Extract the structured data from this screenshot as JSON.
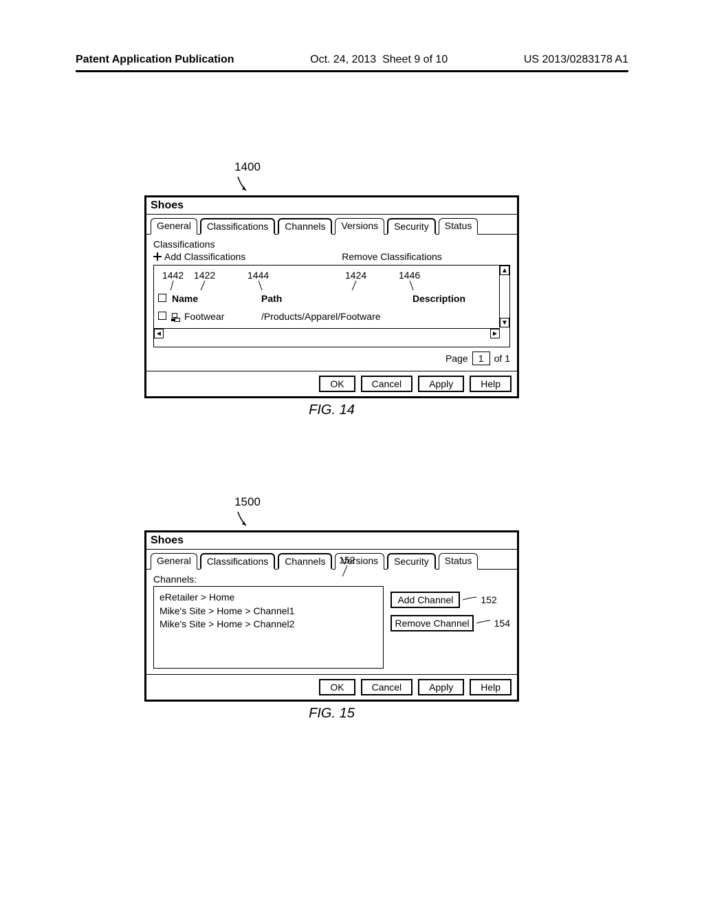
{
  "header": {
    "left": "Patent Application Publication",
    "date": "Oct. 24, 2013",
    "sheet": "Sheet 9 of 10",
    "pubnum": "US 2013/0283178 A1"
  },
  "fig14": {
    "ref": "1400",
    "title": "Shoes",
    "tabs": [
      "General",
      "Classifications",
      "Channels",
      "Versions",
      "Security",
      "Status"
    ],
    "panel_title": "Classifications",
    "link_add": "Add Classifications",
    "link_remove": "Remove Classifications",
    "col_name": "Name",
    "col_path": "Path",
    "col_desc": "Description",
    "row_name": "Footwear",
    "row_path": "/Products/Apparel/Footware",
    "refnums": {
      "a": "1442",
      "b": "1422",
      "c": "1444",
      "d": "1424",
      "e": "1446"
    },
    "pager_page": "Page",
    "pager_current": "1",
    "pager_of": "of 1",
    "buttons": {
      "ok": "OK",
      "cancel": "Cancel",
      "apply": "Apply",
      "help": "Help"
    },
    "caption": "FIG. 14"
  },
  "fig15": {
    "ref": "1500",
    "title": "Shoes",
    "tabs": [
      "General",
      "Classifications",
      "Channels",
      "Versions",
      "Security",
      "Status"
    ],
    "panel_label": "Channels:",
    "ref_center": "152",
    "channels": [
      "eRetailer > Home",
      "Mike's Site > Home > Channel1",
      "Mike's Site > Home > Channel2"
    ],
    "btn_add": "Add Channel",
    "btn_remove": "Remove Channel",
    "ref_add": "152",
    "ref_remove": "154",
    "buttons": {
      "ok": "OK",
      "cancel": "Cancel",
      "apply": "Apply",
      "help": "Help"
    },
    "caption": "FIG. 15"
  }
}
